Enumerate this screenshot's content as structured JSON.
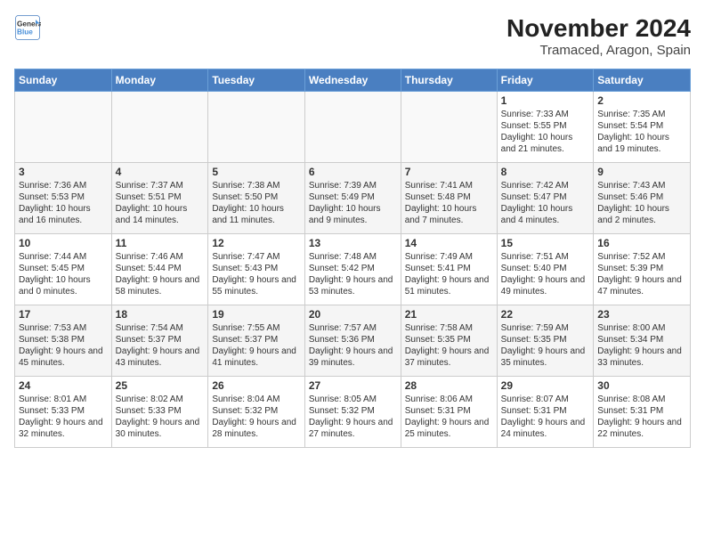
{
  "logo": {
    "line1": "General",
    "line2": "Blue"
  },
  "title": "November 2024",
  "subtitle": "Tramaced, Aragon, Spain",
  "weekdays": [
    "Sunday",
    "Monday",
    "Tuesday",
    "Wednesday",
    "Thursday",
    "Friday",
    "Saturday"
  ],
  "weeks": [
    [
      {
        "day": "",
        "text": ""
      },
      {
        "day": "",
        "text": ""
      },
      {
        "day": "",
        "text": ""
      },
      {
        "day": "",
        "text": ""
      },
      {
        "day": "",
        "text": ""
      },
      {
        "day": "1",
        "text": "Sunrise: 7:33 AM\nSunset: 5:55 PM\nDaylight: 10 hours and 21 minutes."
      },
      {
        "day": "2",
        "text": "Sunrise: 7:35 AM\nSunset: 5:54 PM\nDaylight: 10 hours and 19 minutes."
      }
    ],
    [
      {
        "day": "3",
        "text": "Sunrise: 7:36 AM\nSunset: 5:53 PM\nDaylight: 10 hours and 16 minutes."
      },
      {
        "day": "4",
        "text": "Sunrise: 7:37 AM\nSunset: 5:51 PM\nDaylight: 10 hours and 14 minutes."
      },
      {
        "day": "5",
        "text": "Sunrise: 7:38 AM\nSunset: 5:50 PM\nDaylight: 10 hours and 11 minutes."
      },
      {
        "day": "6",
        "text": "Sunrise: 7:39 AM\nSunset: 5:49 PM\nDaylight: 10 hours and 9 minutes."
      },
      {
        "day": "7",
        "text": "Sunrise: 7:41 AM\nSunset: 5:48 PM\nDaylight: 10 hours and 7 minutes."
      },
      {
        "day": "8",
        "text": "Sunrise: 7:42 AM\nSunset: 5:47 PM\nDaylight: 10 hours and 4 minutes."
      },
      {
        "day": "9",
        "text": "Sunrise: 7:43 AM\nSunset: 5:46 PM\nDaylight: 10 hours and 2 minutes."
      }
    ],
    [
      {
        "day": "10",
        "text": "Sunrise: 7:44 AM\nSunset: 5:45 PM\nDaylight: 10 hours and 0 minutes."
      },
      {
        "day": "11",
        "text": "Sunrise: 7:46 AM\nSunset: 5:44 PM\nDaylight: 9 hours and 58 minutes."
      },
      {
        "day": "12",
        "text": "Sunrise: 7:47 AM\nSunset: 5:43 PM\nDaylight: 9 hours and 55 minutes."
      },
      {
        "day": "13",
        "text": "Sunrise: 7:48 AM\nSunset: 5:42 PM\nDaylight: 9 hours and 53 minutes."
      },
      {
        "day": "14",
        "text": "Sunrise: 7:49 AM\nSunset: 5:41 PM\nDaylight: 9 hours and 51 minutes."
      },
      {
        "day": "15",
        "text": "Sunrise: 7:51 AM\nSunset: 5:40 PM\nDaylight: 9 hours and 49 minutes."
      },
      {
        "day": "16",
        "text": "Sunrise: 7:52 AM\nSunset: 5:39 PM\nDaylight: 9 hours and 47 minutes."
      }
    ],
    [
      {
        "day": "17",
        "text": "Sunrise: 7:53 AM\nSunset: 5:38 PM\nDaylight: 9 hours and 45 minutes."
      },
      {
        "day": "18",
        "text": "Sunrise: 7:54 AM\nSunset: 5:37 PM\nDaylight: 9 hours and 43 minutes."
      },
      {
        "day": "19",
        "text": "Sunrise: 7:55 AM\nSunset: 5:37 PM\nDaylight: 9 hours and 41 minutes."
      },
      {
        "day": "20",
        "text": "Sunrise: 7:57 AM\nSunset: 5:36 PM\nDaylight: 9 hours and 39 minutes."
      },
      {
        "day": "21",
        "text": "Sunrise: 7:58 AM\nSunset: 5:35 PM\nDaylight: 9 hours and 37 minutes."
      },
      {
        "day": "22",
        "text": "Sunrise: 7:59 AM\nSunset: 5:35 PM\nDaylight: 9 hours and 35 minutes."
      },
      {
        "day": "23",
        "text": "Sunrise: 8:00 AM\nSunset: 5:34 PM\nDaylight: 9 hours and 33 minutes."
      }
    ],
    [
      {
        "day": "24",
        "text": "Sunrise: 8:01 AM\nSunset: 5:33 PM\nDaylight: 9 hours and 32 minutes."
      },
      {
        "day": "25",
        "text": "Sunrise: 8:02 AM\nSunset: 5:33 PM\nDaylight: 9 hours and 30 minutes."
      },
      {
        "day": "26",
        "text": "Sunrise: 8:04 AM\nSunset: 5:32 PM\nDaylight: 9 hours and 28 minutes."
      },
      {
        "day": "27",
        "text": "Sunrise: 8:05 AM\nSunset: 5:32 PM\nDaylight: 9 hours and 27 minutes."
      },
      {
        "day": "28",
        "text": "Sunrise: 8:06 AM\nSunset: 5:31 PM\nDaylight: 9 hours and 25 minutes."
      },
      {
        "day": "29",
        "text": "Sunrise: 8:07 AM\nSunset: 5:31 PM\nDaylight: 9 hours and 24 minutes."
      },
      {
        "day": "30",
        "text": "Sunrise: 8:08 AM\nSunset: 5:31 PM\nDaylight: 9 hours and 22 minutes."
      }
    ]
  ]
}
